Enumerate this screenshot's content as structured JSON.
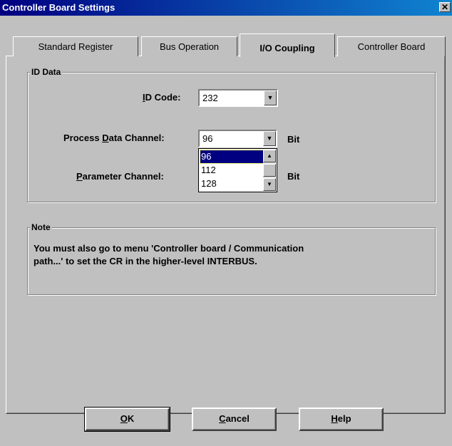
{
  "window": {
    "title": "Controller Board Settings",
    "close_glyph": "✕"
  },
  "tabs": [
    {
      "label": "Standard Register",
      "active": false
    },
    {
      "label": "Bus Operation",
      "active": false
    },
    {
      "label": "I/O Coupling",
      "active": true
    },
    {
      "label": "Controller Board",
      "active": false
    }
  ],
  "id_data": {
    "group_label": "ID Data",
    "id_code": {
      "label_prefix": "",
      "label_mnemonic": "I",
      "label_rest": "D Code:",
      "value": "232"
    },
    "process_data_channel": {
      "label_prefix": "Process ",
      "label_mnemonic": "D",
      "label_rest": "ata Channel:",
      "value": "96",
      "unit": "Bit"
    },
    "parameter_channel": {
      "label_prefix": "",
      "label_mnemonic": "P",
      "label_rest": "arameter Channel:",
      "unit": "Bit"
    },
    "dropdown_options": [
      "96",
      "112",
      "128"
    ],
    "dropdown_selected": "96"
  },
  "note": {
    "group_label": "Note",
    "line1": "You must also go to menu 'Controller board / Communication",
    "line2": "path...' to set the CR in the higher-level INTERBUS."
  },
  "buttons": {
    "ok": {
      "mnemonic": "O",
      "rest": "K"
    },
    "cancel": {
      "mnemonic": "C",
      "rest": "ancel"
    },
    "help": {
      "mnemonic": "H",
      "rest": "elp"
    }
  },
  "icons": {
    "combo_arrow": "▼",
    "scroll_up": "▲",
    "scroll_down": "▼"
  }
}
